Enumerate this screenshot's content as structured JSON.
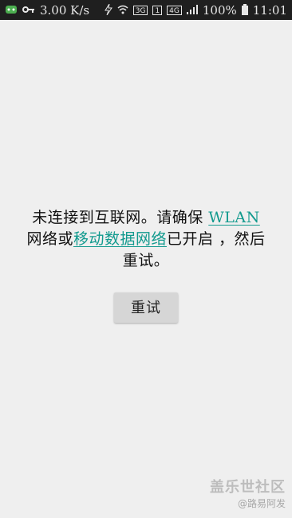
{
  "status_bar": {
    "network_speed": "3.00 K/s",
    "network_type_3g": "3G",
    "network_type_4g": "4G",
    "sim_badge": "1",
    "battery_percent": "100%",
    "time": "11:01",
    "icons": [
      "app-notification-icon",
      "key-icon",
      "data-off-icon",
      "wifi-icon",
      "sim-icon",
      "signal-icon",
      "battery-icon"
    ]
  },
  "error": {
    "line1_prefix": "未连接到互联网。请确保 ",
    "wlan_link": "WLAN",
    "line2_prefix": "网络或",
    "mobile_link": "移动数据网络",
    "line2_suffix": "已开启 ，然后",
    "line3": "重试。"
  },
  "retry_button_label": "重试",
  "watermark": {
    "brand": "盖乐世社区",
    "user": "@路易阿发"
  },
  "colors": {
    "link": "#129a8e",
    "background": "#efefef",
    "status_bar": "#1f1f1f",
    "button": "#d6d6d6"
  }
}
